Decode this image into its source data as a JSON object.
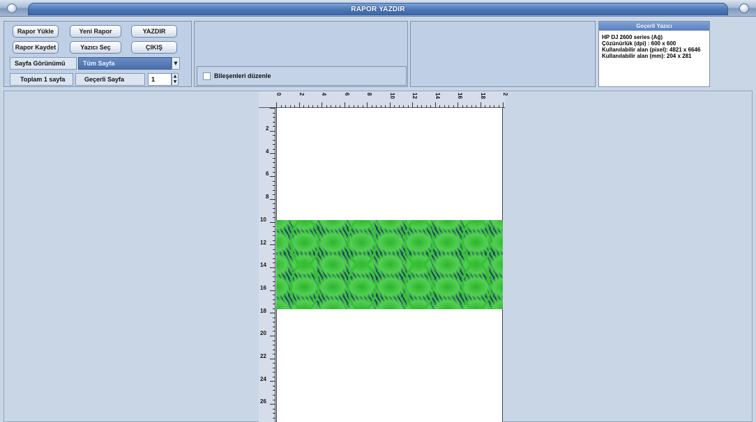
{
  "window": {
    "title": "RAPOR YAZDIR"
  },
  "toolbar": {
    "load_report": "Rapor Yükle",
    "new_report": "Yeni Rapor",
    "print": "YAZDIR",
    "save_report": "Rapor Kaydet",
    "select_printer": "Yazıcı Seç",
    "exit": "ÇIKIŞ"
  },
  "view": {
    "label": "Sayfa Görünümü",
    "selected": "Tüm Sayfa"
  },
  "pages": {
    "total": "Toplam 1 sayfa",
    "current_label": "Geçerli Sayfa",
    "current_value": "1"
  },
  "edit_components": {
    "label": "Bileşenleri düzenle",
    "checked": false
  },
  "printer": {
    "header": "Geçerli Yazıcı",
    "name": "HP DJ 2600 series (Ağ)",
    "resolution": "Çözünürlük (dpi) : 600 x 600",
    "area_pixel": "Kullanılabilir alan (pixel): 4821 x 6646",
    "area_mm": "Kullanılabilir alan (mm): 204 x 281"
  },
  "ruler": {
    "top_labels": [
      "0",
      "2",
      "4",
      "6",
      "8",
      "10",
      "12",
      "14",
      "16",
      "18",
      "2"
    ],
    "left_labels": [
      "2",
      "4",
      "6",
      "8",
      "10",
      "12",
      "14",
      "16",
      "18",
      "20",
      "22",
      "24",
      "26"
    ]
  },
  "colors": {
    "accent": "#4e79b8",
    "pattern_green": "#35c235",
    "pattern_navy": "#1d3d6b"
  }
}
